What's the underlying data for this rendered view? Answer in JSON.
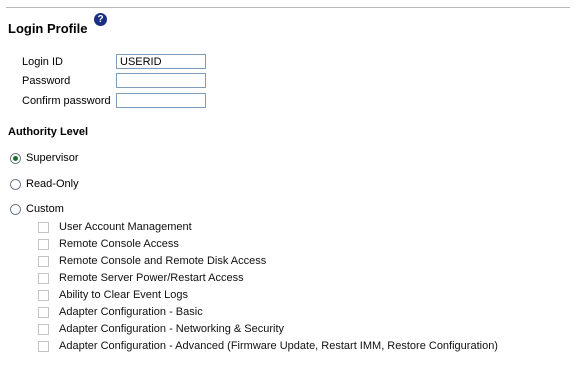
{
  "title": "Login Profile",
  "help_icon": "question-icon",
  "fields": {
    "login_id": {
      "label": "Login ID",
      "value": "USERID"
    },
    "password": {
      "label": "Password",
      "value": ""
    },
    "confirm": {
      "label": "Confirm password",
      "value": ""
    }
  },
  "authority": {
    "heading": "Authority Level",
    "options": [
      {
        "label": "Supervisor",
        "selected": true
      },
      {
        "label": "Read-Only",
        "selected": false
      },
      {
        "label": "Custom",
        "selected": false
      }
    ],
    "permissions": [
      "User Account Management",
      "Remote Console Access",
      "Remote Console and Remote Disk Access",
      "Remote Server Power/Restart Access",
      "Ability to Clear Event Logs",
      "Adapter Configuration - Basic",
      "Adapter Configuration - Networking & Security",
      "Adapter Configuration - Advanced (Firmware Update, Restart IMM, Restore Configuration)"
    ]
  }
}
